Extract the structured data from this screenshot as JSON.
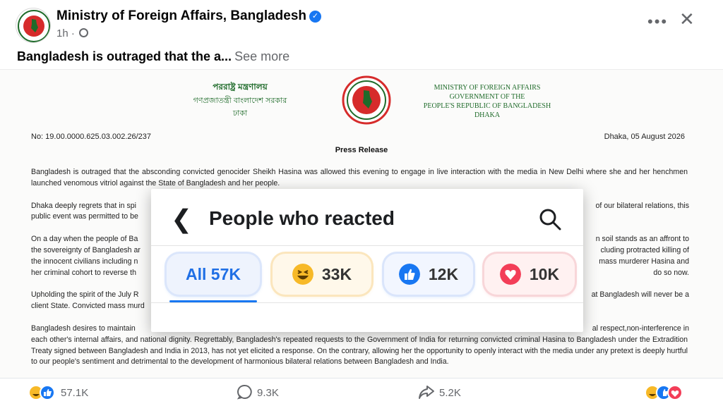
{
  "post": {
    "page_name": "Ministry of Foreign Affairs, Bangladesh",
    "time": "1h",
    "caption": "Bangladesh is outraged that the a...",
    "see_more": "See more"
  },
  "document": {
    "bangla_lines": [
      "পররাষ্ট্র মন্ত্রণালয়",
      "গণপ্রজাতন্ত্রী বাংলাদেশ সরকার",
      "ঢাকা"
    ],
    "english_lines": [
      "MINISTRY OF FOREIGN AFFAIRS",
      "GOVERNMENT OF THE",
      "PEOPLE'S REPUBLIC OF BANGLADESH",
      "DHAKA"
    ],
    "number": "No: 19.00.0000.625.03.002.26/237",
    "date": "Dhaka, 05 August 2026",
    "heading": "Press Release",
    "paragraphs": [
      "Bangladesh is outraged that the absconding convicted genocider Sheikh Hasina was allowed this evening to engage in live interaction with the media in New Delhi where she and her henchmen launched venomous vitriol against the State of Bangladesh and her people.",
      "Dhaka deeply regrets that in spi",
      "of our bilateral relations, this",
      "public event was permitted to be",
      "On a day when the people of Ba",
      "n soil stands as an affront to",
      "the sovereignty of Bangladesh ar",
      "cluding protracted killing of",
      "the innocent civilians including n",
      "mass murderer Hasina and",
      "her criminal cohort to reverse th",
      "do so now.",
      "Upholding the spirit of the July R",
      "at Bangladesh will never be a",
      "client State. Convicted mass murd",
      "Bangladesh desires to maintain",
      "al respect,non-interference in",
      "each other's internal affairs, and national dignity. Regrettably, Bangladesh's repeated requests to the Government of India for returning convicted criminal Hasina to Bangladesh under the Extradition Treaty signed between Bangladesh and India in 2013, has not yet elicited a response. On the contrary, allowing her the opportunity to openly interact with the media under any pretext is deeply hurtful to our people's sentiment and detrimental to the development of harmonious bilateral relations between Bangladesh and India."
    ]
  },
  "reactions_panel": {
    "title": "People who reacted",
    "tabs": [
      {
        "label": "All 57K",
        "icon": "none"
      },
      {
        "label": "33K",
        "icon": "haha-icon"
      },
      {
        "label": "12K",
        "icon": "like-icon"
      },
      {
        "label": "10K",
        "icon": "love-icon"
      }
    ]
  },
  "footer": {
    "reactions_count": "57.1K",
    "comments_count": "9.3K",
    "shares_count": "5.2K"
  },
  "colors": {
    "accent": "#1877f2",
    "doc_green": "#1f6b2a",
    "seal_red": "#d62b2b",
    "love": "#f33e58",
    "haha": "#f7b928"
  }
}
